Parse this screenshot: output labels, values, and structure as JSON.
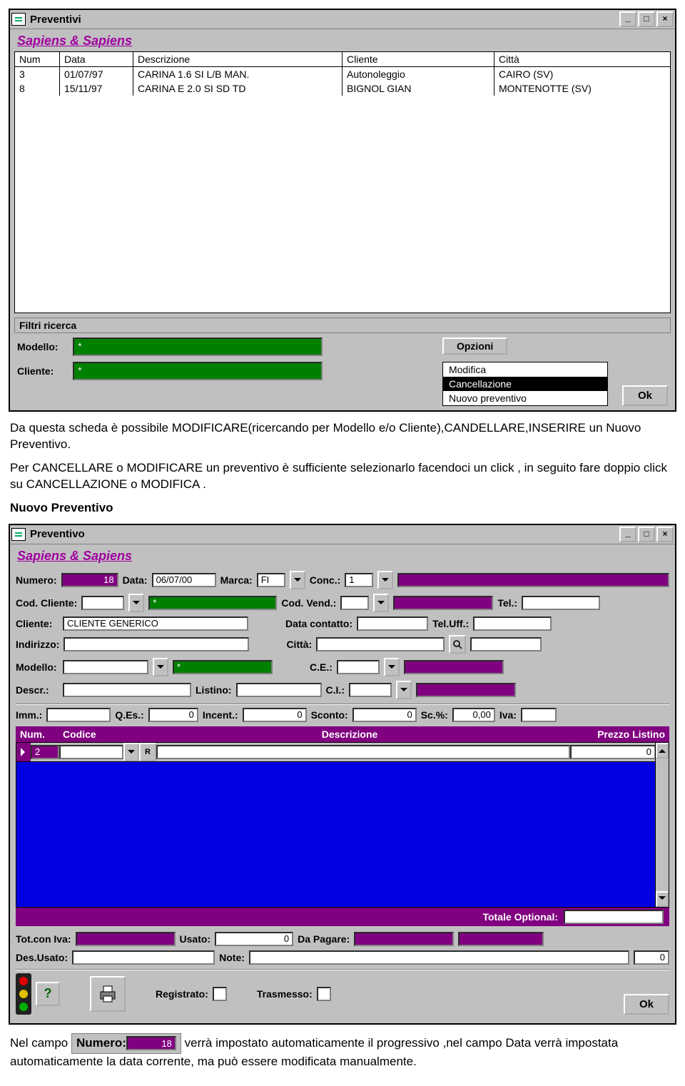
{
  "win1": {
    "title": "Preventivi",
    "brand": "Sapiens & Sapiens",
    "columns": [
      "Num",
      "Data",
      "Descrizione",
      "Cliente",
      "Città"
    ],
    "rows": [
      {
        "num": "3",
        "data": "01/07/97",
        "descr": "CARINA 1.6 SI L/B MAN.",
        "cliente": "Autonoleggio",
        "citta": "CAIRO  (SV)"
      },
      {
        "num": "8",
        "data": "15/11/97",
        "descr": "CARINA E 2.0 SI SD TD",
        "cliente": "BIGNOL GIAN",
        "citta": "MONTENOTTE (SV)"
      }
    ],
    "filter_section": "Filtri ricerca",
    "filter_modello_lbl": "Modello:",
    "filter_cliente_lbl": "Cliente:",
    "filter_modello_val": "*",
    "filter_cliente_val": "*",
    "opzioni_btn": "Opzioni",
    "options": [
      "Modifica",
      "Cancellazione",
      "Nuovo preventivo"
    ],
    "selected_option_index": 1,
    "ok": "Ok"
  },
  "para1": "Da questa scheda è possibile MODIFICARE(ricercando per Modello e/o Cliente),CANDELLARE,INSERIRE un Nuovo Preventivo.",
  "para2": "Per CANCELLARE o MODIFICARE un preventivo è sufficiente selezionarlo facendoci un click , in seguito fare doppio click su CANCELLAZIONE o MODIFICA .",
  "heading2": "Nuovo Preventivo",
  "win2": {
    "title": "Preventivo",
    "brand": "Sapiens & Sapiens",
    "labels": {
      "numero": "Numero:",
      "data": "Data:",
      "marca": "Marca:",
      "conc": "Conc.:",
      "cod_cliente": "Cod. Cliente:",
      "cod_vend": "Cod. Vend.:",
      "tel": "Tel.:",
      "cliente": "Cliente:",
      "data_contatto": "Data contatto:",
      "tel_uff": "Tel.Uff.:",
      "indirizzo": "Indirizzo:",
      "citta": "Città:",
      "modello": "Modello:",
      "ce": "C.E.:",
      "descr": "Descr.:",
      "listino": "Listino:",
      "ci": "C.I.:",
      "imm": "Imm.:",
      "qes": "Q.Es.:",
      "incent": "Incent.:",
      "sconto": "Sconto:",
      "scperc": "Sc.%:",
      "iva": "Iva:",
      "grid_num": "Num.",
      "grid_codice": "Codice",
      "grid_descr": "Descrizione",
      "grid_prezzo": "Prezzo Listino",
      "tot_optional": "Totale Optional:",
      "tot_iva": "Tot.con Iva:",
      "usato": "Usato:",
      "da_pagare": "Da Pagare:",
      "des_usato": "Des.Usato:",
      "note": "Note:",
      "registrato": "Registrato:",
      "trasmesso": "Trasmesso:",
      "ok": "Ok",
      "r_btn": "R"
    },
    "values": {
      "numero": "18",
      "data": "06/07/00",
      "marca": "FI",
      "conc": "1",
      "conc_name": "",
      "cod_cliente": "",
      "cod_cliente_name": "*",
      "cod_vend": "",
      "cod_vend_name": "",
      "tel": "",
      "cliente": "CLIENTE GENERICO",
      "data_contatto": "",
      "tel_uff": "",
      "indirizzo": "",
      "citta": "",
      "modello": "",
      "modello_name": "*",
      "ce": "",
      "descr": "",
      "listino": "",
      "ci": "",
      "imm": "",
      "qes": "0",
      "incent": "0",
      "sconto": "0",
      "scperc": "0,00",
      "iva": "",
      "grid_num": "2",
      "grid_codice": "",
      "grid_descr": "",
      "grid_prezzo": "0",
      "tot_optional": "",
      "tot_iva": "",
      "usato": "0",
      "da_pagare": "",
      "da_pagare2": "",
      "des_usato": "",
      "note": "",
      "note_qty": "0"
    }
  },
  "snippet": {
    "numero_lbl": "Numero:",
    "numero_val": "18"
  },
  "para3a": "Nel campo ",
  "para3b": " verrà impostato automaticamente il progressivo ,nel campo Data verrà impostata automaticamente  la data corrente, ma può essere modificata manualmente."
}
